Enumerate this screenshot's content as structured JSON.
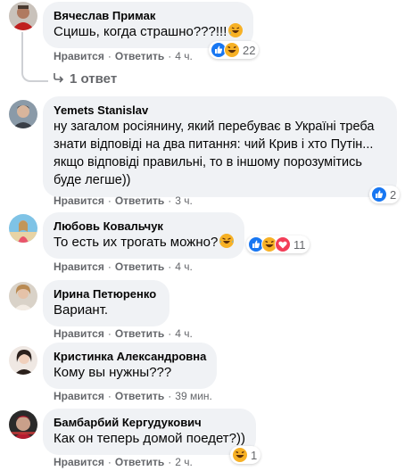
{
  "actions": {
    "like": "Нравится",
    "reply": "Ответить"
  },
  "comments": [
    {
      "author": "Вячеслав Примак",
      "text": "Сцишь, когда страшно???!!!",
      "time": "4 ч.",
      "reaction_count": "22",
      "reactions": [
        "like-icon",
        "haha-icon"
      ],
      "replies_label": "1 ответ"
    },
    {
      "author": "Yemets Stanislav",
      "text": "ну загалом росіянину, який перебуває в Україні треба знати відповіді на два питання: чий Крив і хто Путін... якщо відповіді правильні, то в іншому порозумітись буде легше))",
      "time": "3 ч.",
      "reaction_count": "2",
      "reactions": [
        "like-icon"
      ]
    },
    {
      "author": "Любовь Ковальчук",
      "text": "То есть их трогать можно?",
      "time": "4 ч.",
      "reaction_count": "11",
      "reactions": [
        "like-icon",
        "haha-icon",
        "love-icon"
      ]
    },
    {
      "author": "Ирина Петюренко",
      "text": "Вариант.",
      "time": "4 ч."
    },
    {
      "author": "Кристинка Александровна",
      "text": "Кому вы нужны???",
      "time": "39 мин."
    },
    {
      "author": "Бамбарбий Кергудукович",
      "text": "Как он теперь домой поедет?))",
      "time": "2 ч.",
      "reaction_count": "1",
      "reactions": [
        "haha-icon"
      ]
    }
  ],
  "colors": {
    "bubble": "#f0f2f5",
    "meta_text": "#65676b",
    "like_blue": "#1877f2",
    "haha_yellow": "#f7b125",
    "love_red": "#f33e58"
  }
}
